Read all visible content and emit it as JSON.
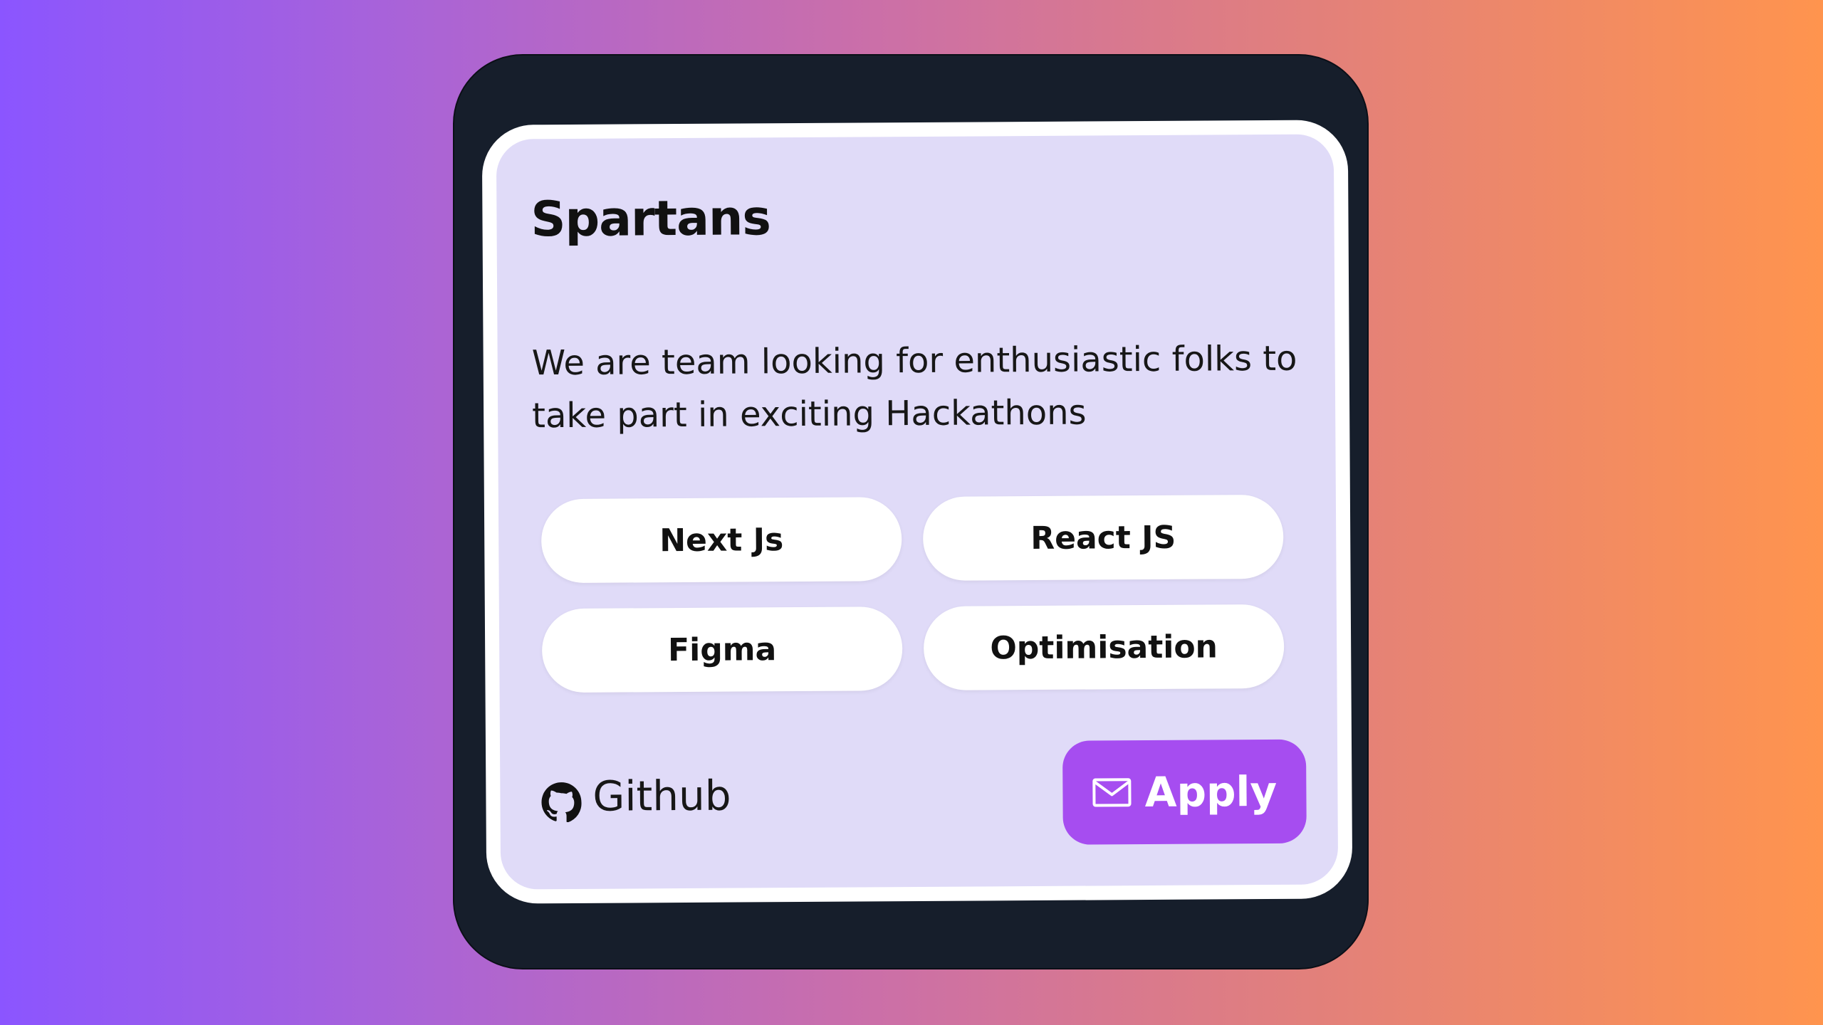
{
  "card": {
    "title": "Spartans",
    "description": "We are team looking for enthusiastic folks to take part in exciting Hackathons",
    "tags": [
      "Next Js",
      "React JS",
      "Figma",
      "Optimisation"
    ],
    "github_label": "Github",
    "apply_label": "Apply"
  },
  "colors": {
    "background_start": "#8b55ff",
    "background_end": "#ff944e",
    "frame": "#161e2b",
    "card": "#e0dbf8",
    "card_border": "#ffffff",
    "tag": "#ffffff",
    "apply_button": "#a64df0",
    "text": "#171717"
  },
  "icons": {
    "github": "github-icon",
    "apply": "mail-icon"
  }
}
